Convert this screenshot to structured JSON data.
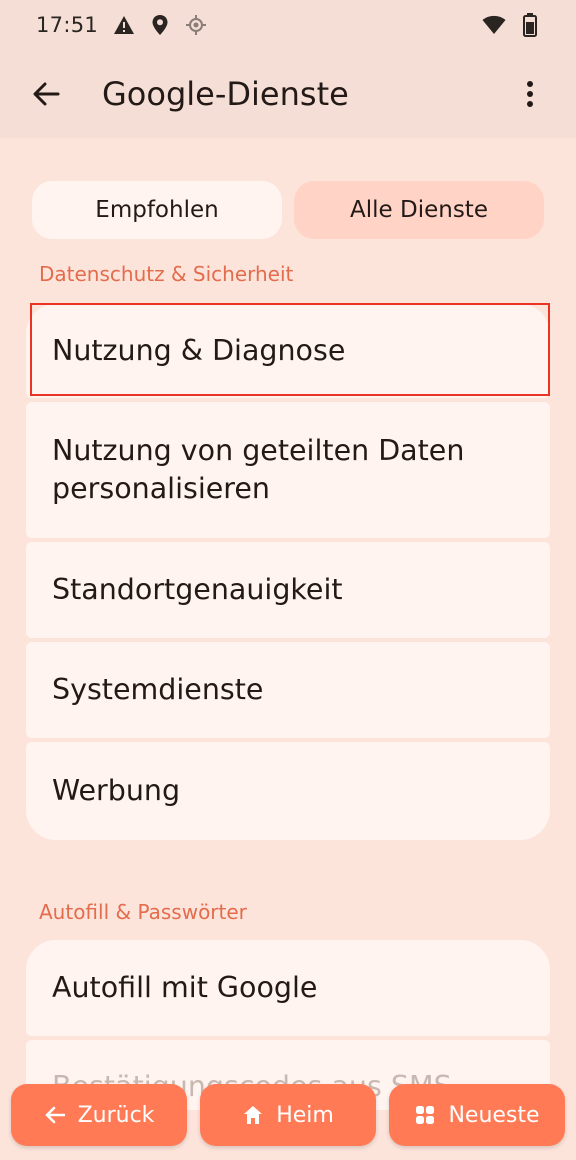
{
  "statusbar": {
    "time": "17:51",
    "icons": [
      "warning-icon",
      "location-pin-icon",
      "gps-icon",
      "wifi-icon",
      "battery-icon"
    ]
  },
  "appbar": {
    "title": "Google-Dienste",
    "back_icon": "arrow-left-icon",
    "menu_icon": "more-vert-icon"
  },
  "tabs": {
    "recommended": "Empfohlen",
    "all_services": "Alle Dienste",
    "selected": "Alle Dienste"
  },
  "sections": {
    "privacy": {
      "header": "Datenschutz & Sicherheit",
      "items": [
        "Nutzung & Diagnose",
        "Nutzung von geteilten Daten personalisieren",
        "Standortgenauigkeit",
        "Systemdienste",
        "Werbung"
      ]
    },
    "autofill": {
      "header": "Autofill & Passwörter",
      "items": [
        "Autofill mit Google",
        "Bestätigungscodes aus SMS"
      ]
    }
  },
  "navbar": {
    "back": "Zurück",
    "home": "Heim",
    "recent": "Neueste"
  },
  "colors": {
    "background": "#fde4db",
    "accent": "#ff7a55",
    "section_header": "#e36c4c",
    "highlight": "#ea3323"
  }
}
